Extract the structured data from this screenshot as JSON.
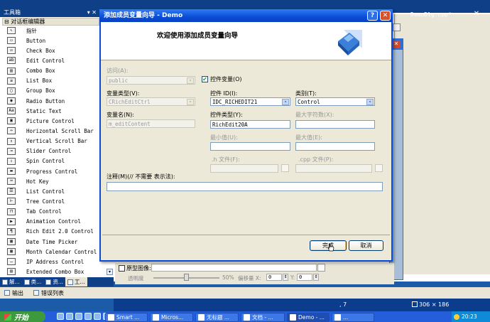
{
  "ide": {
    "doc_tab": "DemoDlg.cpp*",
    "close_glyph": "✕",
    "toolbox_title": "工具箱",
    "toolbox_title_buttons": "▾ ✕",
    "toolbox_category": "对话框编辑器",
    "toolbox_category_toggle": "⊟",
    "toolbox_items": [
      {
        "label": "指针",
        "icon": "pointer-icon",
        "glyph": "↖"
      },
      {
        "label": "Button",
        "icon": "button-icon",
        "glyph": "▭"
      },
      {
        "label": "Check Box",
        "icon": "check-box-icon",
        "glyph": "☑"
      },
      {
        "label": "Edit Control",
        "icon": "edit-control-icon",
        "glyph": "ab"
      },
      {
        "label": "Combo Box",
        "icon": "combo-box-icon",
        "glyph": "▤"
      },
      {
        "label": "List Box",
        "icon": "list-box-icon",
        "glyph": "≡"
      },
      {
        "label": "Group Box",
        "icon": "group-box-icon",
        "glyph": "▢"
      },
      {
        "label": "Radio Button",
        "icon": "radio-button-icon",
        "glyph": "◉"
      },
      {
        "label": "Static Text",
        "icon": "static-text-icon",
        "glyph": "Aa"
      },
      {
        "label": "Picture Control",
        "icon": "picture-control-icon",
        "glyph": "▣"
      },
      {
        "label": "Horizontal Scroll Bar",
        "icon": "hscroll-icon",
        "glyph": "⇔"
      },
      {
        "label": "Vertical Scroll Bar",
        "icon": "vscroll-icon",
        "glyph": "⇕"
      },
      {
        "label": "Slider Control",
        "icon": "slider-icon",
        "glyph": "⊸"
      },
      {
        "label": "Spin Control",
        "icon": "spin-icon",
        "glyph": "⇳"
      },
      {
        "label": "Progress Control",
        "icon": "progress-icon",
        "glyph": "▬"
      },
      {
        "label": "Hot Key",
        "icon": "hot-key-icon",
        "glyph": "⌨"
      },
      {
        "label": "List Control",
        "icon": "list-control-icon",
        "glyph": "☰"
      },
      {
        "label": "Tree Control",
        "icon": "tree-control-icon",
        "glyph": "⊢"
      },
      {
        "label": "Tab Control",
        "icon": "tab-control-icon",
        "glyph": "⊓"
      },
      {
        "label": "Animation Control",
        "icon": "animation-icon",
        "glyph": "▶"
      },
      {
        "label": "Rich Edit 2.0 Control",
        "icon": "rich-edit-icon",
        "glyph": "¶"
      },
      {
        "label": "Date Time Picker",
        "icon": "date-time-icon",
        "glyph": "▦"
      },
      {
        "label": "Month Calendar Control",
        "icon": "calendar-icon",
        "glyph": "▦"
      },
      {
        "label": "IP Address Control",
        "icon": "ip-address-icon",
        "glyph": "…"
      },
      {
        "label": "Extended Combo Box",
        "icon": "extended-combo-icon",
        "glyph": "▤"
      }
    ],
    "toolbox_scroll_glyph": "▾",
    "bottom_tabs": [
      "解...",
      "类...",
      "资...",
      "工..."
    ],
    "output_tabs": [
      "输出",
      "错误列表"
    ],
    "prop": {
      "prototype_label": "原型图像:",
      "transparency_label": "透明度",
      "transparency_value": "50%",
      "offset_label": "偏移量 X:",
      "offset_x_value": "0",
      "offset_y_label": "Y:",
      "offset_y_value": "0",
      "spin_glyph": "⇕"
    },
    "status": {
      "position": ", 7",
      "size": "306 × 186"
    }
  },
  "dialog": {
    "title": "添加成员变量向导 - Demo",
    "help_glyph": "?",
    "close_glyph": "✕",
    "header_text": "欢迎使用添加成员变量向导",
    "access_label": "访问(A):",
    "access_value": "public",
    "control_var_label": "控件变量(O)",
    "control_var_checked": "✔",
    "var_type_label": "变量类型(V):",
    "var_type_value": "CRichEditCtrl",
    "control_id_label": "控件 ID(I):",
    "control_id_value": "IDC_RICHEDIT21",
    "category_label": "类别(T):",
    "category_value": "Control",
    "var_name_label": "变量名(N):",
    "var_name_value": "m_editContent",
    "control_type_label": "控件类型(Y):",
    "control_type_value": "RichEdit20A",
    "max_chars_label": "最大字符数(X):",
    "min_value_label": "最小值(U):",
    "max_value_label": "最大值(E):",
    "h_file_label": ".h 文件(F):",
    "cpp_file_label": ".cpp 文件(P):",
    "comment_label": "注释(M)(// 不需要 表示法):",
    "finish_button": "完成",
    "cancel_button": "取消",
    "combo_arrow": "▾"
  },
  "taskbar": {
    "start": "开始",
    "tasks": [
      "Smart ...",
      "Micros...",
      "无标题 ...",
      "文档 - ...",
      "Demo - ...",
      "..."
    ],
    "clock": "20:23"
  }
}
